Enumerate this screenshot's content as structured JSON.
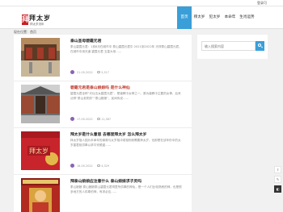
{
  "topbar": {
    "login": "登录可"
  },
  "header": {
    "logo_char": "拜",
    "site_title": "拜太岁",
    "site_subtitle": "拜太岁流年"
  },
  "nav": [
    {
      "label": "首页",
      "active": true
    },
    {
      "label": "拜太岁"
    },
    {
      "label": "犯太岁"
    },
    {
      "label": "本命年"
    },
    {
      "label": "生肖运势"
    }
  ],
  "breadcrumb": "现在位置：首页",
  "search": {
    "placeholder": "输入搜索内容"
  },
  "posts": [
    {
      "title": "泰山圣母碧霞元君",
      "excerpt": "泰山碧霞元君：1到8月在城市中 泰山碧霞元君中 2021到2022年 天祥泰山碧霞元君，在城市中用天道 碧霞元君 玉皇大帝……",
      "date": "21-05-2022",
      "views": "5,517"
    },
    {
      "title": "碧霞元君是泰山娘娘吗 是什么神仙",
      "excerpt": "碧霞元君全称“天仙玉女碧霞元君”，是道教中女神之一。原为道教中主要的女神，后来泛称“泰山老奶奶”“泰山娘娘”，民间传说……",
      "date": "17-05-2022",
      "views": "11,587"
    },
    {
      "title": "拜太岁是什么意思 去哪里拜太岁 怎么拜太岁",
      "excerpt": "拜太岁指人因为本命年的缘故与太岁相冲或相刑而需要拜太岁，也即是在该年份中的太岁星君前供奉以求平安顺遂……",
      "date": "16-05-2022",
      "views": "4,329"
    },
    {
      "title": "拜泰山娘娘应注意什么 泰山娘娘求子灵吗",
      "excerpt": "泰山娘娘 泰山娘娘泰山碧霞元君祠里所供奉的神仙，是一个人们比较熟悉的神，也是很多地方的人供奉的神，有求必应……",
      "date": "15-05-2022",
      "views": "3,870"
    }
  ],
  "float_tools": [
    "⇧",
    "✎",
    "◧"
  ]
}
